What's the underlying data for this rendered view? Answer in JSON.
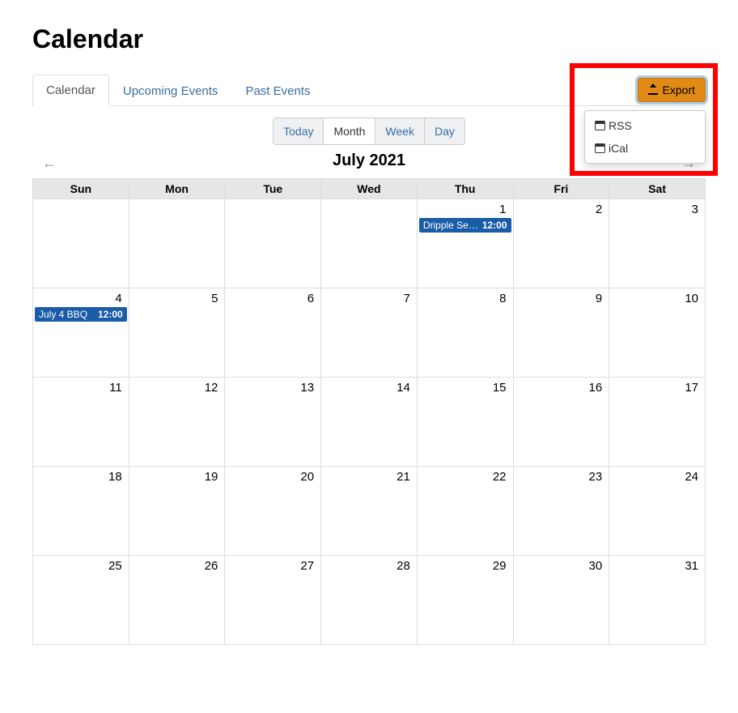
{
  "page_title": "Calendar",
  "tabs": [
    {
      "label": "Calendar",
      "active": true
    },
    {
      "label": "Upcoming Events",
      "active": false
    },
    {
      "label": "Past Events",
      "active": false
    }
  ],
  "export": {
    "button_label": "Export",
    "menu": [
      {
        "label": "RSS"
      },
      {
        "label": "iCal"
      }
    ]
  },
  "view_buttons": {
    "today": "Today",
    "month": "Month",
    "week": "Week",
    "day": "Day",
    "active": "Month"
  },
  "month_label": "July 2021",
  "day_headers": [
    "Sun",
    "Mon",
    "Tue",
    "Wed",
    "Thu",
    "Fri",
    "Sat"
  ],
  "weeks": [
    [
      {
        "num": ""
      },
      {
        "num": ""
      },
      {
        "num": ""
      },
      {
        "num": ""
      },
      {
        "num": "1",
        "events": [
          {
            "title": "Dripple Se…",
            "time": "12:00"
          }
        ]
      },
      {
        "num": "2"
      },
      {
        "num": "3"
      }
    ],
    [
      {
        "num": "4",
        "events": [
          {
            "title": "July 4 BBQ",
            "time": "12:00"
          }
        ]
      },
      {
        "num": "5"
      },
      {
        "num": "6"
      },
      {
        "num": "7"
      },
      {
        "num": "8"
      },
      {
        "num": "9"
      },
      {
        "num": "10"
      }
    ],
    [
      {
        "num": "11"
      },
      {
        "num": "12"
      },
      {
        "num": "13"
      },
      {
        "num": "14"
      },
      {
        "num": "15"
      },
      {
        "num": "16"
      },
      {
        "num": "17"
      }
    ],
    [
      {
        "num": "18"
      },
      {
        "num": "19"
      },
      {
        "num": "20"
      },
      {
        "num": "21"
      },
      {
        "num": "22"
      },
      {
        "num": "23"
      },
      {
        "num": "24"
      }
    ],
    [
      {
        "num": "25"
      },
      {
        "num": "26"
      },
      {
        "num": "27"
      },
      {
        "num": "28"
      },
      {
        "num": "29"
      },
      {
        "num": "30"
      },
      {
        "num": "31"
      }
    ]
  ]
}
